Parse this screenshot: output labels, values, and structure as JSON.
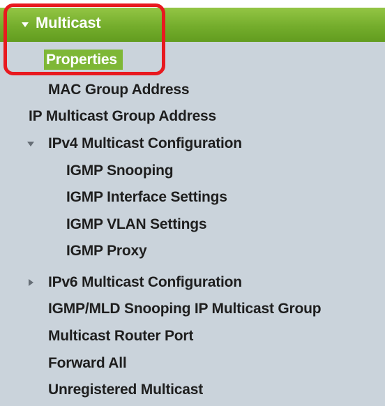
{
  "menu": {
    "title": "Multicast",
    "selected": "Properties",
    "items": [
      "MAC Group Address",
      "IP Multicast Group Address",
      "IPv4 Multicast Configuration",
      "IGMP Snooping",
      "IGMP Interface Settings",
      "IGMP VLAN Settings",
      "IGMP Proxy",
      "IPv6 Multicast Configuration",
      "IGMP/MLD Snooping IP Multicast Group",
      "Multicast Router Port",
      "Forward All",
      "Unregistered Multicast"
    ]
  },
  "annotation": {
    "color": "#e8191f"
  },
  "colors": {
    "header_green": "#74ad2c",
    "selected_green": "#7eb736",
    "menu_background": "#cad3db"
  }
}
